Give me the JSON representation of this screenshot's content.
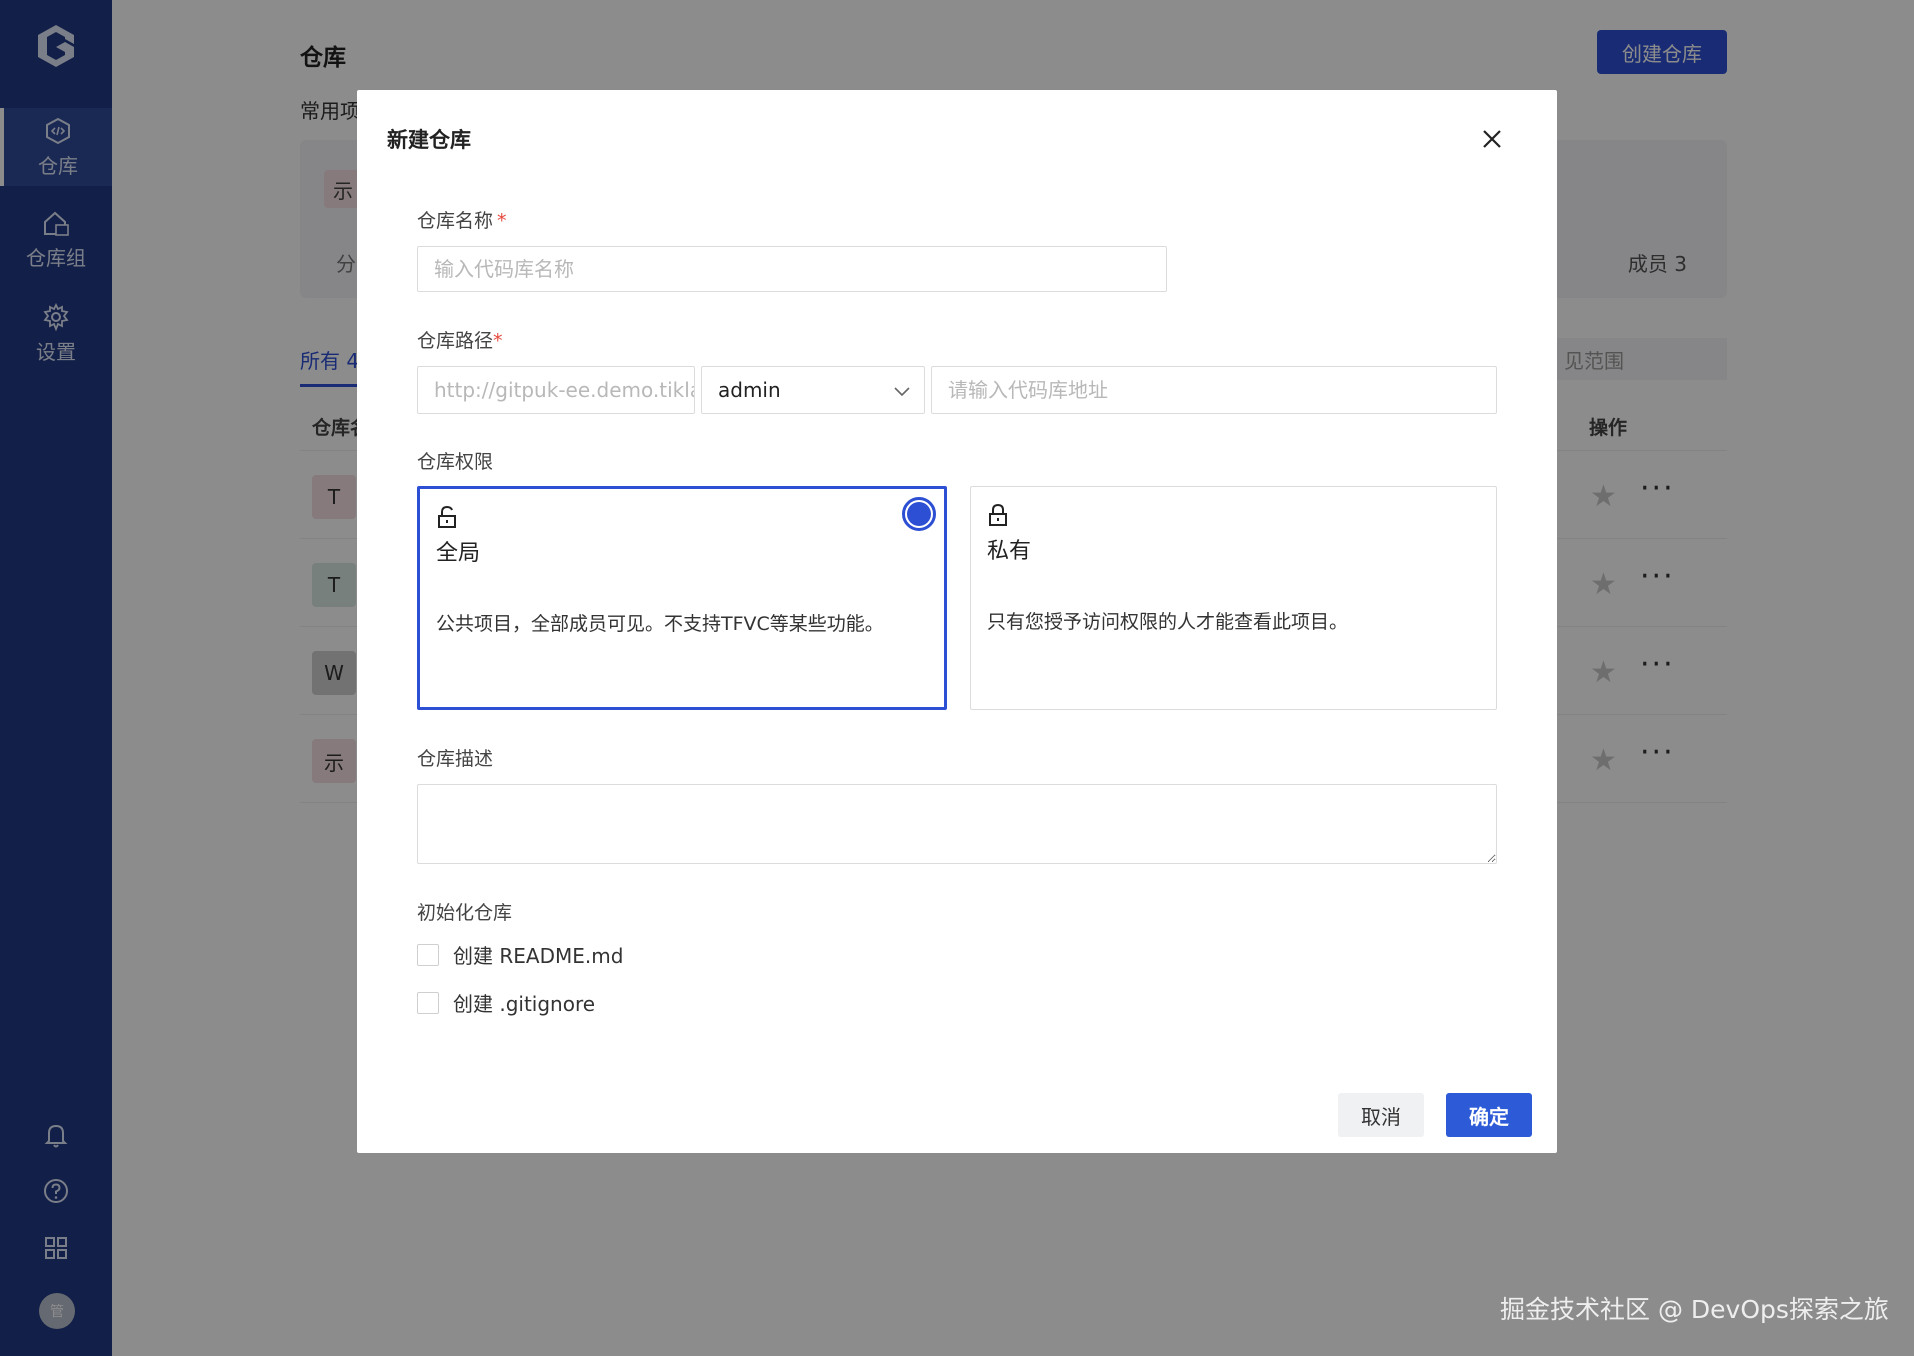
{
  "sidebar": {
    "items": [
      {
        "label": "仓库",
        "icon": "code-repo-icon"
      },
      {
        "label": "仓库组",
        "icon": "repo-group-icon"
      },
      {
        "label": "设置",
        "icon": "gear-icon"
      }
    ],
    "bottom_icons": [
      "bell-icon",
      "help-icon",
      "apps-grid-icon"
    ],
    "avatar_text": "管"
  },
  "page": {
    "title": "仓库",
    "create_button": "创建仓库",
    "recent_section_label": "常用项",
    "recent_card": {
      "badge": "示",
      "group_label": "分",
      "members": "成员 3"
    },
    "tab_all": "所有 4",
    "scope_placeholder": "见范围",
    "col_name": "仓库名",
    "col_ops": "操作",
    "rows": [
      {
        "badge": "T",
        "color": "#f6dfe2"
      },
      {
        "badge": "T",
        "color": "#dbe9e4"
      },
      {
        "badge": "W",
        "color": "#cfcfcf"
      },
      {
        "badge": "示",
        "color": "#f6dfe2"
      }
    ]
  },
  "modal": {
    "title": "新建仓库",
    "name_label": "仓库名称",
    "name_placeholder": "输入代码库名称",
    "path_label": "仓库路径",
    "path_prefix_placeholder": "http://gitpuk-ee.demo.tiklab.net",
    "path_owner": "admin",
    "path_placeholder": "请输入代码库地址",
    "permission_label": "仓库权限",
    "perm_public": {
      "title": "全局",
      "desc": "公共项目，全部成员可见。不支持TFVC等某些功能。"
    },
    "perm_private": {
      "title": "私有",
      "desc": "只有您授予访问权限的人才能查看此项目。"
    },
    "desc_label": "仓库描述",
    "init_label": "初始化仓库",
    "init_readme": "创建 README.md",
    "init_gitignore": "创建 .gitignore",
    "cancel": "取消",
    "confirm": "确定",
    "required_mark": "*"
  },
  "watermark": "掘金技术社区 @ DevOps探索之旅",
  "colors": {
    "sidebar": "#223a84",
    "primary": "#2d4fd3",
    "required": "#e5483d"
  }
}
